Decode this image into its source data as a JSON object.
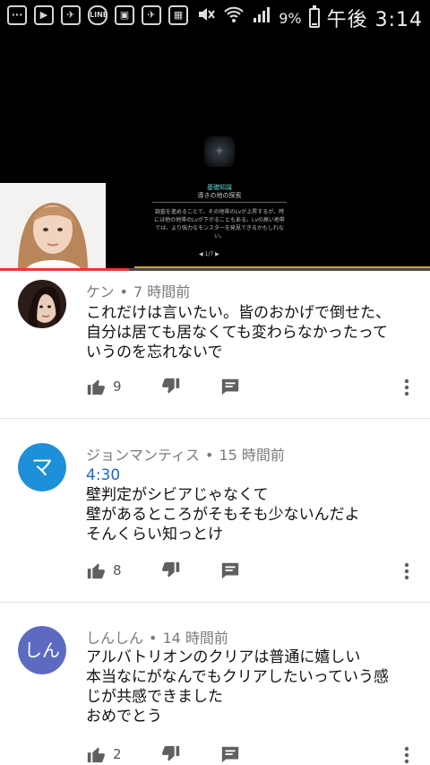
{
  "status_bar": {
    "left_icons": [
      "···",
      "▶",
      "✈",
      "LINE",
      "▣",
      "✈",
      "▦"
    ],
    "battery_pct": "9%",
    "battery_level": 0.09,
    "time": "午後 3:14"
  },
  "video": {
    "game_title": "基礎知識",
    "game_subtitle": "導きの地の探索",
    "game_body": "調査を進めることで、その地帯のLvが上昇するが、時には他の地帯のLvが下がることもある。Lvの高い地帯では、より強力なモンスターを発見できるかもしれない。",
    "game_pager": "◀  1/7  ▶",
    "progress": 0.3
  },
  "comments": [
    {
      "author": "ケン",
      "time": "7 時間前",
      "timestamp": "",
      "text": "これだけは言いたい。皆のおかげで倒せた、\n自分は居ても居なくても変わらなかったって\nいうのを忘れないで",
      "likes": "9",
      "avatar_letter": "",
      "avatar_color": "#6b4a3a"
    },
    {
      "author": "ジョンマンティス",
      "time": "15 時間前",
      "timestamp": "4:30",
      "text": "壁判定がシビアじゃなくて\n壁があるところがそもそも少ないんだよ\nそんくらい知っとけ",
      "likes": "8",
      "avatar_letter": "マ",
      "avatar_color": "#1e8fd9"
    },
    {
      "author": "しんしん",
      "time": "14 時間前",
      "timestamp": "",
      "text": "アルバトリオンのクリアは普通に嬉しい\n本当なにがなんでもクリアしたいっていう感\nじが共感できました\nおめでとう",
      "likes": "2",
      "avatar_letter": "しん",
      "avatar_color": "#5c6bc0"
    }
  ],
  "meta_separator": "•"
}
